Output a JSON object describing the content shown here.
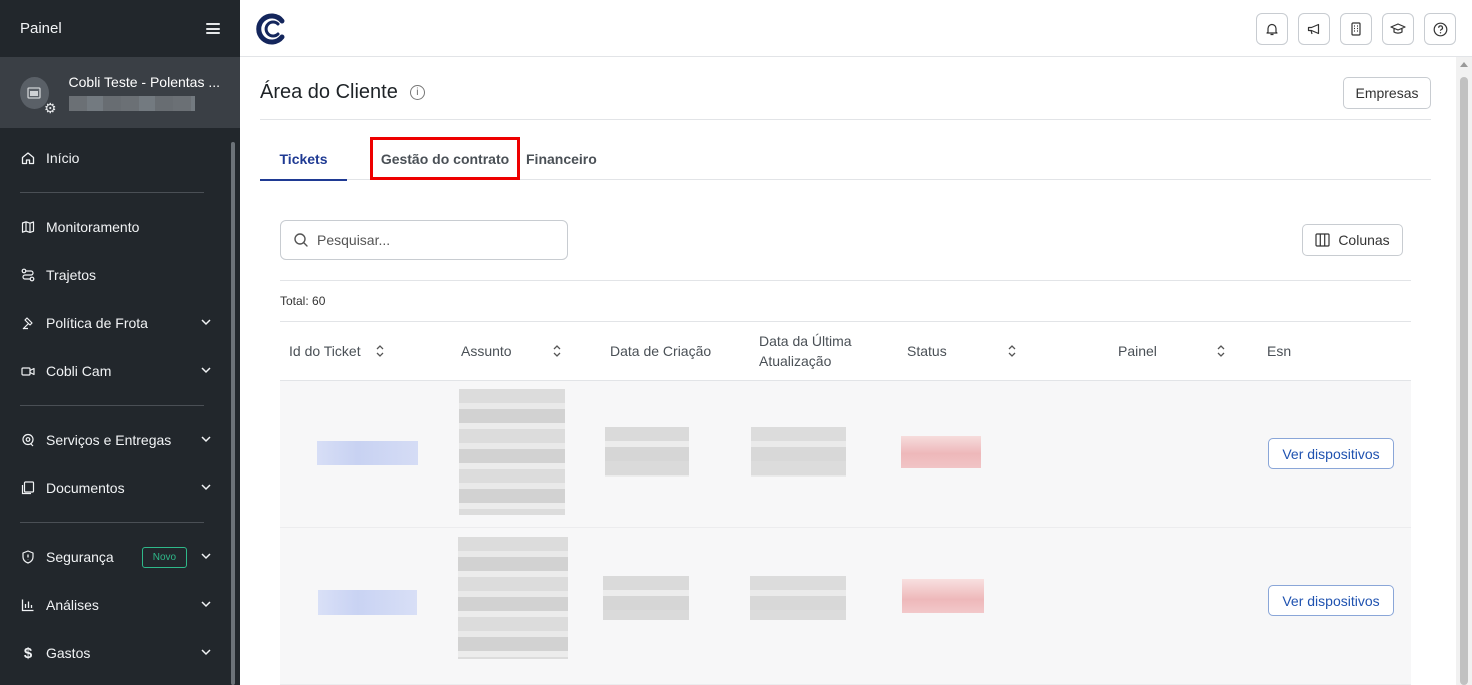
{
  "sidebar": {
    "title": "Painel",
    "account": {
      "name": "Cobli Teste - Polentas ..."
    },
    "items": [
      {
        "label": "Início",
        "icon": "home-icon"
      },
      {
        "label": "Monitoramento",
        "icon": "map-icon"
      },
      {
        "label": "Trajetos",
        "icon": "route-icon"
      },
      {
        "label": "Política de Frota",
        "icon": "gavel-icon"
      },
      {
        "label": "Cobli Cam",
        "icon": "camera-icon"
      },
      {
        "label": "Serviços e Entregas",
        "icon": "location-pin-icon"
      },
      {
        "label": "Documentos",
        "icon": "documents-icon"
      },
      {
        "label": "Segurança",
        "icon": "shield-icon",
        "badge": "Novo"
      },
      {
        "label": "Análises",
        "icon": "chart-icon"
      },
      {
        "label": "Gastos",
        "icon": "dollar-icon"
      }
    ]
  },
  "header": {
    "title": "Área do Cliente",
    "empresas_label": "Empresas"
  },
  "tabs": [
    {
      "label": "Tickets",
      "active": true
    },
    {
      "label": "Gestão do contrato",
      "active": false,
      "highlighted": true
    },
    {
      "label": "Financeiro",
      "active": false
    }
  ],
  "search": {
    "placeholder": "Pesquisar..."
  },
  "columns_button": "Colunas",
  "total": "Total: 60",
  "table": {
    "headers": [
      {
        "label": "Id do Ticket",
        "sortable": true
      },
      {
        "label": "Assunto",
        "sortable": true
      },
      {
        "label": "Data de Criação",
        "sortable": false
      },
      {
        "label": "Data da Última Atualização",
        "sortable": false
      },
      {
        "label": "Status",
        "sortable": true
      },
      {
        "label": "Painel",
        "sortable": true
      },
      {
        "label": "Esn",
        "sortable": false
      }
    ],
    "rows": [
      {
        "action": "Ver dispositivos"
      },
      {
        "action": "Ver dispositivos"
      }
    ]
  },
  "colors": {
    "accent": "#1f3a93",
    "sidebar_bg": "#22272c",
    "highlight": "#ee0000",
    "badge": "#2fb98a"
  }
}
